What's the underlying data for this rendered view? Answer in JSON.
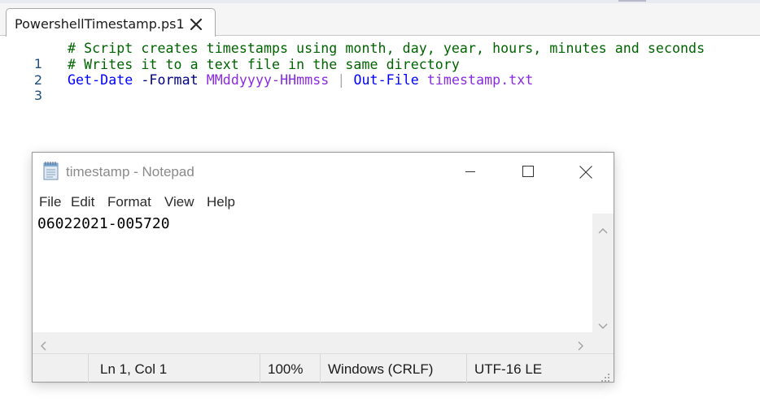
{
  "ise": {
    "tab_title": "PowershellTimestamp.ps1",
    "lines": [
      {
        "number": "1",
        "tokens": [
          {
            "text": "# Script creates timestamps using month, day, year, hours, minutes and seconds",
            "color": "#006400"
          }
        ]
      },
      {
        "number": "2",
        "tokens": [
          {
            "text": "# Writes it to a text file in the same directory",
            "color": "#006400"
          }
        ]
      },
      {
        "number": "3",
        "tokens": [
          {
            "text": "Get-Date",
            "color": "#0000ff"
          },
          {
            "text": " ",
            "color": "#000000"
          },
          {
            "text": "-Format",
            "color": "#000080"
          },
          {
            "text": " ",
            "color": "#000000"
          },
          {
            "text": "MMddyyyy-HHmmss",
            "color": "#8a2be2"
          },
          {
            "text": " ",
            "color": "#000000"
          },
          {
            "text": "|",
            "color": "#a9a9a9"
          },
          {
            "text": " ",
            "color": "#000000"
          },
          {
            "text": "Out-File",
            "color": "#0000ff"
          },
          {
            "text": " ",
            "color": "#000000"
          },
          {
            "text": "timestamp.txt",
            "color": "#8a2be2"
          }
        ]
      }
    ]
  },
  "notepad": {
    "title": "timestamp - Notepad",
    "menu": [
      "File",
      "Edit",
      "Format",
      "View",
      "Help"
    ],
    "content": "06022021-005720",
    "status": {
      "position": "Ln 1, Col 1",
      "zoom": "100%",
      "line_ending": "Windows (CRLF)",
      "encoding": "UTF-16 LE"
    }
  }
}
